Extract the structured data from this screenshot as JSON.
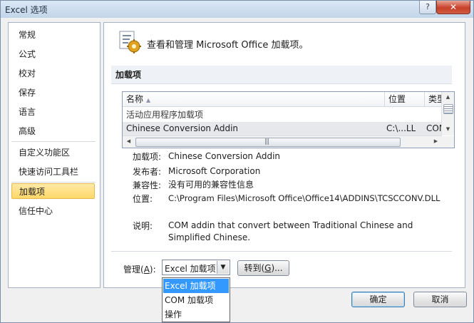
{
  "window": {
    "title": "Excel 选项",
    "help_label": "?",
    "close_label": "✕"
  },
  "nav": {
    "items": [
      {
        "label": "常规"
      },
      {
        "label": "公式"
      },
      {
        "label": "校对"
      },
      {
        "label": "保存"
      },
      {
        "label": "语言"
      },
      {
        "label": "高级"
      },
      {
        "label": "自定义功能区"
      },
      {
        "label": "快速访问工具栏"
      },
      {
        "label": "加载项",
        "selected": true
      },
      {
        "label": "信任中心"
      }
    ]
  },
  "header": {
    "text": "查看和管理 Microsoft Office 加载项。",
    "icon": "addins-gear-icon"
  },
  "section": {
    "title": "加载项"
  },
  "addins_list": {
    "columns": [
      "名称",
      "位置",
      "类型"
    ],
    "sort_indicator": "▲",
    "group_label": "活动应用程序加载项",
    "rows": [
      {
        "name": "Chinese Conversion Addin",
        "location": "C:\\...LL",
        "type": "COM"
      }
    ],
    "h_grip": "|||"
  },
  "details": {
    "addin_label": "加载项:",
    "addin_value": "Chinese Conversion Addin",
    "publisher_label": "发布者:",
    "publisher_value": "Microsoft Corporation",
    "compat_label": "兼容性:",
    "compat_value": "没有可用的兼容性信息",
    "location_label": "位置:",
    "location_value": "C:\\Program Files\\Microsoft Office\\Office14\\ADDINS\\TCSCCONV.DLL",
    "desc_label": "说明:",
    "desc_value": "COM addin that convert between Traditional Chinese and Simplified Chinese."
  },
  "manage": {
    "label_prefix": "管理(",
    "label_accel": "A",
    "label_suffix": "):",
    "selected": "Excel 加载项",
    "options": [
      "Excel 加载项",
      "COM 加载项",
      "操作"
    ],
    "go_prefix": "转到(",
    "go_accel": "G",
    "go_suffix": ")..."
  },
  "footer": {
    "ok_label": "确定",
    "cancel_label": "取消"
  }
}
